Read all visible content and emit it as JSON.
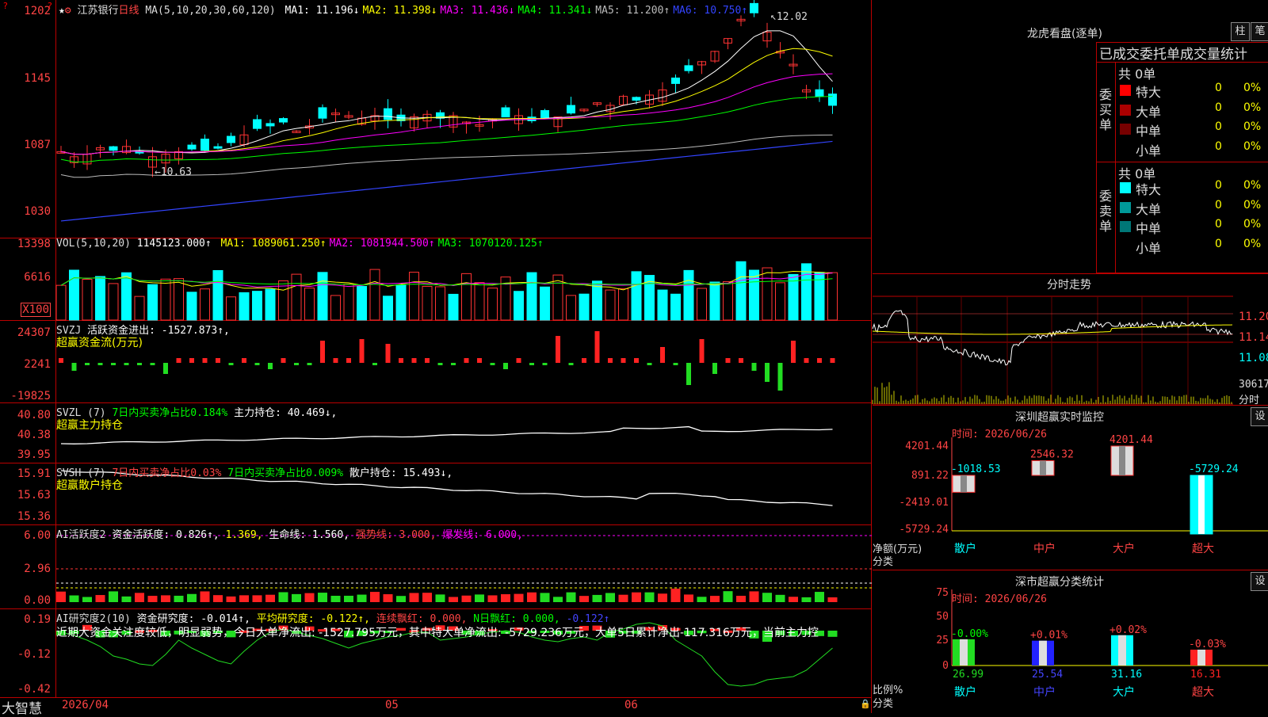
{
  "app": {
    "name": "大智慧"
  },
  "main": {
    "stock": "江苏银行",
    "period": "日线",
    "ma_header": "MA(5,10,20,30,60,120)",
    "ma": [
      {
        "label": "MA1:",
        "value": "11.196↓",
        "color": "#ffffff"
      },
      {
        "label": "MA2:",
        "value": "11.398↓",
        "color": "#ffff00"
      },
      {
        "label": "MA3:",
        "value": "11.436↓",
        "color": "#ff00ff"
      },
      {
        "label": "MA4:",
        "value": "11.341↓",
        "color": "#00ff00"
      },
      {
        "label": "MA5:",
        "value": "11.200↑",
        "color": "#bbbbbb"
      },
      {
        "label": "MA6:",
        "value": "10.750↑",
        "color": "#3344ff"
      }
    ],
    "yticks": [
      "1202",
      "1145",
      "1087",
      "1030"
    ],
    "high_marker": "12.02",
    "low_marker": "10.63",
    "dates": [
      "2026/04",
      "05",
      "06"
    ]
  },
  "vol": {
    "header": "VOL(5,10,20)",
    "value": "1145123.000↑",
    "ma": [
      {
        "label": "MA1:",
        "value": "1089061.250↑",
        "color": "#ffff00"
      },
      {
        "label": "MA2:",
        "value": "1081944.500↑",
        "color": "#ff00ff"
      },
      {
        "label": "MA3:",
        "value": "1070120.125↑",
        "color": "#00ff00"
      }
    ],
    "yticks": [
      "13398",
      "6616",
      "X100"
    ]
  },
  "svzj": {
    "code": "SVZJ",
    "text": "活跃资金进出: -1527.873↑,",
    "title": "超赢资金流(万元)",
    "yticks": [
      "24307",
      "2241",
      "-19825"
    ]
  },
  "svzl": {
    "code": "SVZL (7)",
    "t1": "7日内买卖净占比0.184%",
    "t2": "主力持仓: 40.469↓,",
    "title": "超赢主力持仓",
    "yticks": [
      "40.80",
      "40.38",
      "39.95"
    ]
  },
  "svsh": {
    "code": "SVSH (7)",
    "t1": "7日内买卖净占比0.03%",
    "t2": "7日内买卖净占比0.009%",
    "t3": "散户持仓: 15.493↓,",
    "title": "超赢散户持仓",
    "yticks": [
      "15.91",
      "15.63",
      "15.36"
    ]
  },
  "ai1": {
    "code": "AI活跃度2",
    "t1": "资金活跃度: 0.826↑,",
    "t2": "1.369,",
    "t3": "生命线: 1.560,",
    "t4": "强势线: 3.000,",
    "t5": "爆发线: 6.000,",
    "yticks": [
      "6.00",
      "2.96",
      "0.00"
    ]
  },
  "ai2": {
    "code": "AI研究度2(10)",
    "t1": "资金研究度: -0.014↑,",
    "t2": "平均研究度: -0.122↑,",
    "t3": "连续飘红: 0.000,",
    "t4": "N日飘红: 0.000,",
    "t5": "-0.122↑",
    "note": "近期大资金关注度较低，明显弱势，今日大单净流出: -1527.795万元，其中特大单净流出: -5729.236万元，大单5日累计净出-117.316万元，当前主力控",
    "yticks": [
      "0.19",
      "-0.12",
      "-0.42"
    ]
  },
  "longhu": {
    "title": "龙虎看盘(逐单)",
    "btn1": "柱",
    "btn2": "笔",
    "subtitle": "已成交委托单成交量统计",
    "buy_label": "委买单",
    "sell_label": "委卖单",
    "buy_total": "共 0单",
    "sell_total": "共 0单",
    "buy_rows": [
      {
        "name": "特大",
        "count": "0",
        "pct": "0%",
        "color": "#ff0000"
      },
      {
        "name": "大单",
        "count": "0",
        "pct": "0%",
        "color": "#aa0000"
      },
      {
        "name": "中单",
        "count": "0",
        "pct": "0%",
        "color": "#770000"
      },
      {
        "name": "小单",
        "count": "0",
        "pct": "0%",
        "color": "#000000"
      }
    ],
    "sell_rows": [
      {
        "name": "特大",
        "count": "0",
        "pct": "0%",
        "color": "#00ffff"
      },
      {
        "name": "大单",
        "count": "0",
        "pct": "0%",
        "color": "#009999"
      },
      {
        "name": "中单",
        "count": "0",
        "pct": "0%",
        "color": "#007777"
      },
      {
        "name": "小单",
        "count": "0",
        "pct": "0%",
        "color": "#000000"
      }
    ]
  },
  "intraday": {
    "title": "分时走势",
    "yticks": [
      "11.20",
      "11.14",
      "11.08"
    ],
    "vol_tick": "30617",
    "tab": "分时"
  },
  "monitor": {
    "title": "深圳超赢实时监控",
    "btn": "设",
    "time": "时间: 2026/06/26",
    "yticks": [
      "4201.44",
      "891.22",
      "-2419.01",
      "-5729.24"
    ],
    "ylabel": "净额(万元)",
    "xlabel": "分类",
    "cats": [
      "散户",
      "中户",
      "大户",
      "超大"
    ],
    "values": [
      "-1018.53",
      "2546.32",
      "4201.44",
      "-5729.24"
    ]
  },
  "classify": {
    "title": "深市超赢分类统计",
    "btn": "设",
    "time": "时间: 2026/06/26",
    "yticks": [
      "75",
      "50",
      "25",
      "0"
    ],
    "ylabel": "比例%",
    "xlabel": "分类",
    "cats": [
      "散户",
      "中户",
      "大户",
      "超大"
    ],
    "pct_changes": [
      "-0.00%",
      "+0.01%",
      "+0.02%",
      "-0.03%"
    ],
    "values": [
      "26.99",
      "25.54",
      "31.16",
      "16.31"
    ]
  }
}
